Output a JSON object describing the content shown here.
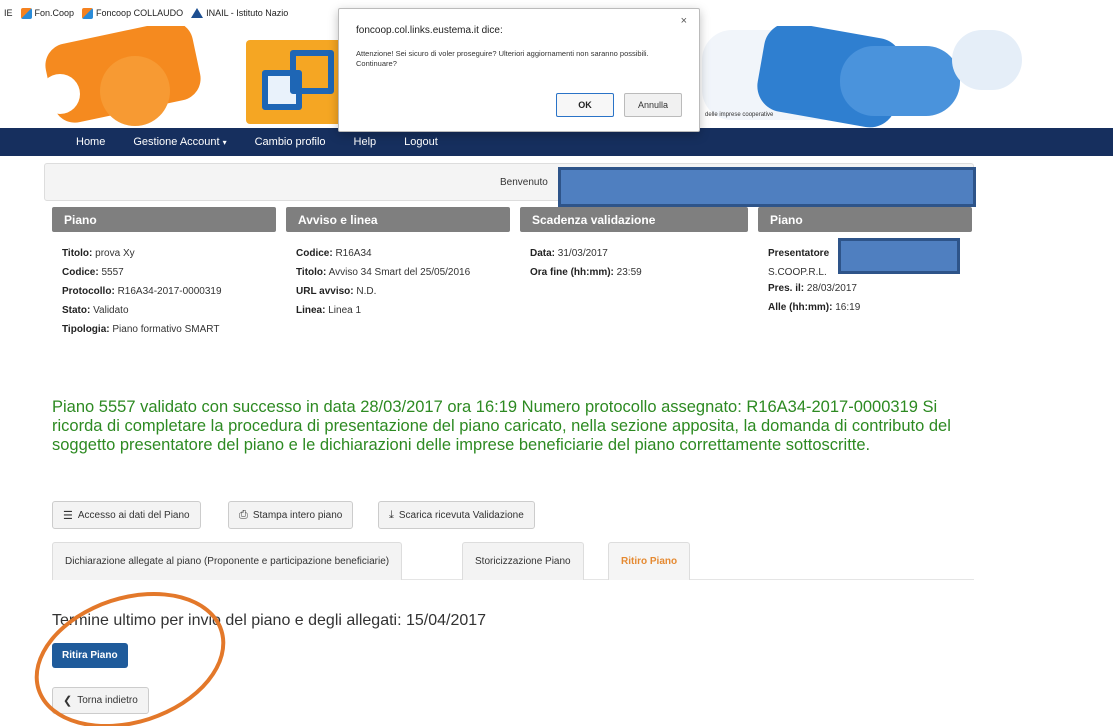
{
  "bookmarks": [
    {
      "label": "IE"
    },
    {
      "label": "Fon.Coop"
    },
    {
      "label": "Foncoop COLLAUDO"
    },
    {
      "label": "INAIL - Istituto Nazio"
    }
  ],
  "header": {
    "tagline": "delle imprese cooperative"
  },
  "nav": {
    "items": [
      "Home",
      "Gestione Account",
      "Cambio profilo",
      "Help",
      "Logout"
    ],
    "caret": "▾"
  },
  "welcome": {
    "text": "Benvenuto"
  },
  "panels": {
    "piano": {
      "title": "Piano",
      "rows": [
        {
          "label": "Titolo:",
          "value": "prova Xy"
        },
        {
          "label": "Codice:",
          "value": "5557"
        },
        {
          "label": "Protocollo:",
          "value": "R16A34-2017-0000319"
        },
        {
          "label": "Stato:",
          "value": "Validato"
        },
        {
          "label": "Tipologia:",
          "value": "Piano formativo SMART"
        }
      ]
    },
    "avviso": {
      "title": "Avviso e linea",
      "rows": [
        {
          "label": "Codice:",
          "value": "R16A34"
        },
        {
          "label": "Titolo:",
          "value": "Avviso 34 Smart del 25/05/2016"
        },
        {
          "label": "URL avviso:",
          "value": "N.D."
        },
        {
          "label": "Linea:",
          "value": "Linea 1"
        }
      ]
    },
    "scadenza": {
      "title": "Scadenza validazione",
      "rows": [
        {
          "label": "Data:",
          "value": "31/03/2017"
        },
        {
          "label": "Ora fine (hh:mm):",
          "value": "23:59"
        }
      ]
    },
    "piano2": {
      "title": "Piano",
      "presentatore_label": "Presentatore",
      "company": "S.COOP.R.L.",
      "rows": [
        {
          "label": "Pres. il:",
          "value": "28/03/2017"
        },
        {
          "label": "Alle (hh:mm):",
          "value": "16:19"
        }
      ]
    }
  },
  "success_message": "Piano 5557 validato con successo in data 28/03/2017 ora 16:19 Numero protocollo assegnato: R16A34-2017-0000319 Si ricorda di completare la procedura di presentazione del piano caricato, nella sezione apposita, la domanda di contributo del soggetto presentatore del piano e le dichiarazioni delle imprese beneficiarie del piano correttamente sottoscritte.",
  "actions": {
    "accesso": "Accesso ai dati del Piano",
    "stampa": "Stampa intero piano",
    "scarica": "Scarica ricevuta Validazione"
  },
  "tabs": [
    {
      "label": "Dichiarazione allegate al piano (Proponente e participazione beneficiarie)"
    },
    {
      "label": "Storicizzazione Piano"
    },
    {
      "label": "Ritiro Piano"
    }
  ],
  "deadline": "Termine ultimo per invio del piano e degli allegati: 15/04/2017",
  "ritira_button": "Ritira Piano",
  "back_button": "Torna indietro",
  "dialog": {
    "title": "foncoop.col.links.eustema.it dice:",
    "close": "×",
    "message": "Attenzione! Sei sicuro di voler proseguire? Ulteriori aggiornamenti non saranno possibili. Continuare?",
    "ok": "OK",
    "cancel": "Annulla"
  },
  "colors": {
    "nav": "#162f5e",
    "panel_head": "#7f7f7f",
    "success": "#2d8a22",
    "primary": "#1f5b9b",
    "active_tab": "#e58a32",
    "annotation": "#e3782a",
    "redaction": "#4f7fc0"
  }
}
